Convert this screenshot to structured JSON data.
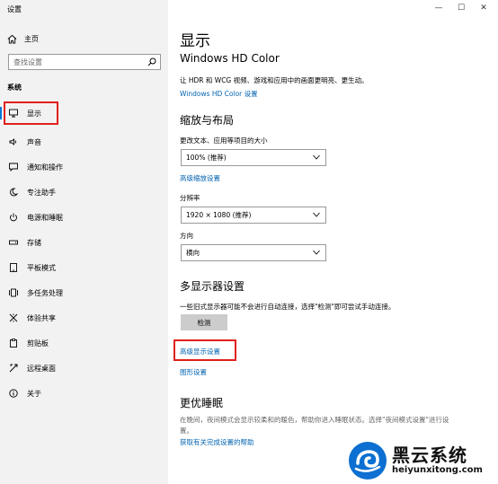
{
  "window": {
    "title": "设置"
  },
  "sidebar": {
    "home_label": "主页",
    "search_placeholder": "查找设置",
    "section_label": "系统",
    "items": [
      {
        "label": "显示",
        "icon": "monitor-icon",
        "active": true
      },
      {
        "label": "声音",
        "icon": "speaker-icon"
      },
      {
        "label": "通知和操作",
        "icon": "message-icon"
      },
      {
        "label": "专注助手",
        "icon": "moon-icon"
      },
      {
        "label": "电源和睡眠",
        "icon": "power-icon"
      },
      {
        "label": "存储",
        "icon": "storage-icon"
      },
      {
        "label": "平板模式",
        "icon": "tablet-icon"
      },
      {
        "label": "多任务处理",
        "icon": "multitask-icon"
      },
      {
        "label": "体验共享",
        "icon": "share-icon"
      },
      {
        "label": "剪贴板",
        "icon": "clipboard-icon"
      },
      {
        "label": "远程桌面",
        "icon": "remote-icon"
      },
      {
        "label": "关于",
        "icon": "info-icon"
      }
    ]
  },
  "main": {
    "title": "显示",
    "hdr": {
      "heading": "Windows HD Color",
      "description": "让 HDR 和 WCG 视频、游戏和应用中的画面更明亮、更生动。",
      "link": "Windows HD Color 设置"
    },
    "scale": {
      "heading": "缩放与布局",
      "text_size_label": "更改文本、应用等项目的大小",
      "text_size_value": "100% (推荐)",
      "advanced_link": "高级缩放设置",
      "resolution_label": "分辨率",
      "resolution_value": "1920 × 1080 (推荐)",
      "orientation_label": "方向",
      "orientation_value": "横向"
    },
    "multi": {
      "heading": "多显示器设置",
      "description": "一些旧式显示器可能不会进行自动连接，选择\"检测\"即可尝试手动连接。",
      "detect_button": "检测",
      "advanced_link": "高级显示设置",
      "graphics_link": "图形设置"
    },
    "sleep": {
      "heading": "更优睡眠",
      "description_line1": "在晚间，夜间模式会显示较柔和的暖色，帮助你进入睡眠状态。选择\"夜间模式设置\"进行设",
      "description_line2": "置。",
      "link": "获取有关完成设置的帮助"
    }
  },
  "watermark": {
    "title": "黑云系统",
    "url": "heiyunxitong.com"
  },
  "colors": {
    "accent": "#0078d7",
    "link": "#0063b1",
    "highlight": "#e0201c",
    "sidebar_bg": "#f2f2f2"
  }
}
